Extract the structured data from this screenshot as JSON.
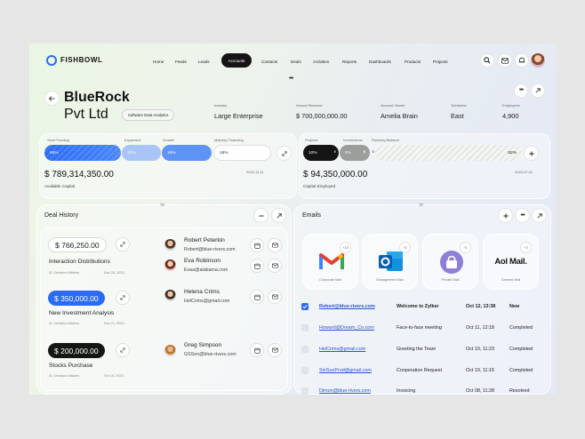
{
  "app": {
    "name": "FISHBOWL"
  },
  "nav": [
    {
      "label": "Home"
    },
    {
      "label": "Feeds"
    },
    {
      "label": "Leads"
    },
    {
      "label": "Accounts"
    },
    {
      "label": "Contacts"
    },
    {
      "label": "Deals"
    },
    {
      "label": "Activities"
    },
    {
      "label": "Reports"
    },
    {
      "label": "Dashboards"
    },
    {
      "label": "Products"
    },
    {
      "label": "Projects"
    }
  ],
  "account": {
    "name_line1": "BlueRock",
    "name_line2": "Pvt Ltd",
    "tag": "Software Data Analytics",
    "fields": [
      {
        "label": "Industry",
        "value": "Large Enterprise"
      },
      {
        "label": "Annual Revenue",
        "value": "$ 700,000,000.00"
      },
      {
        "label": "Account Owner",
        "value": "Amelia Brain"
      },
      {
        "label": "Territories",
        "value": "East"
      },
      {
        "label": "Employees",
        "value": "4,900"
      }
    ]
  },
  "capital": {
    "labels": [
      "Seed Funding",
      "Expansion",
      "Growth",
      "Maturity Financing"
    ],
    "pills": [
      "56%",
      "12%",
      "16%",
      "16%"
    ],
    "pill_fractions": [
      0.56,
      0.12,
      0.16,
      0.16
    ],
    "amount": "$ 789,314,350.00",
    "caption": "Available Capital",
    "date": "2023.11.11"
  },
  "employed": {
    "labels": [
      "Projects",
      "Investments",
      "Planning Balance"
    ],
    "pills": [
      "10%",
      "8%",
      "82%"
    ],
    "pill_fractions": [
      0.1,
      0.08,
      0.82
    ],
    "amount": "$ 94,350,000.00",
    "caption": "Capital Employed",
    "date": "2023.07.01"
  },
  "deals": {
    "title": "Deal History",
    "items": [
      {
        "amount": "$ 766,250.00",
        "title": "Interaction Distributions",
        "sub": "ID, Decision Makers",
        "date": "Nov 26, 2023"
      },
      {
        "amount": "$ 350,000.00",
        "title": "New Investment Analysis",
        "sub": "ID, Decision Makers",
        "date": "Nov 21, 2023"
      },
      {
        "amount": "$ 200,000.00",
        "title": "Stocks Purchase",
        "sub": "ID, Decision Makers",
        "date": "Oct 16, 2023"
      }
    ],
    "contacts": [
      {
        "name": "Robert Peterkin",
        "email": "Robert@blue-rivers.com"
      },
      {
        "name": "Eva Robinson",
        "email": "Evaa@alabama.com"
      },
      {
        "name": "Helena Crims",
        "email": "HelCrims@gmail.com"
      },
      {
        "name": "Greg Simpson",
        "email": "GSSon@blue-rivers.com"
      }
    ]
  },
  "emails": {
    "title": "Emails",
    "providers": [
      {
        "name": "Corporate Mail",
        "badge": "+16",
        "logo": "M"
      },
      {
        "name": "Management Mail",
        "badge": "+2",
        "logo": "O"
      },
      {
        "name": "Private Mail",
        "badge": "+1",
        "logo": "P"
      },
      {
        "name": "General Mail",
        "badge": "+3",
        "logo": "Aol Mail."
      }
    ],
    "rows": [
      {
        "from": "Robert@blue-rivers.com",
        "subject": "Welcome to Zylker",
        "date": "Oct 12, 13:38",
        "status": "New",
        "checked": true
      },
      {
        "from": "Howard@Dream_Co.com",
        "subject": "Face-to-face meeting",
        "date": "Oct 11, 12:18",
        "status": "Completed",
        "checked": false
      },
      {
        "from": "HelCrims@gmail.com",
        "subject": "Greeting the Team",
        "date": "Oct 10, 11:23",
        "status": "Completed",
        "checked": false
      },
      {
        "from": "SinSunProd@gmail.com",
        "subject": "Cooperation Request",
        "date": "Oct 10, 11:15",
        "status": "Completed",
        "checked": false
      },
      {
        "from": "Dimon@blue-rivers.com",
        "subject": "Invoicing",
        "date": "Oct 08, 11:28",
        "status": "Resolved",
        "checked": false
      }
    ]
  },
  "colors": {
    "accent": "#2a6bf2",
    "dark": "#151515"
  }
}
